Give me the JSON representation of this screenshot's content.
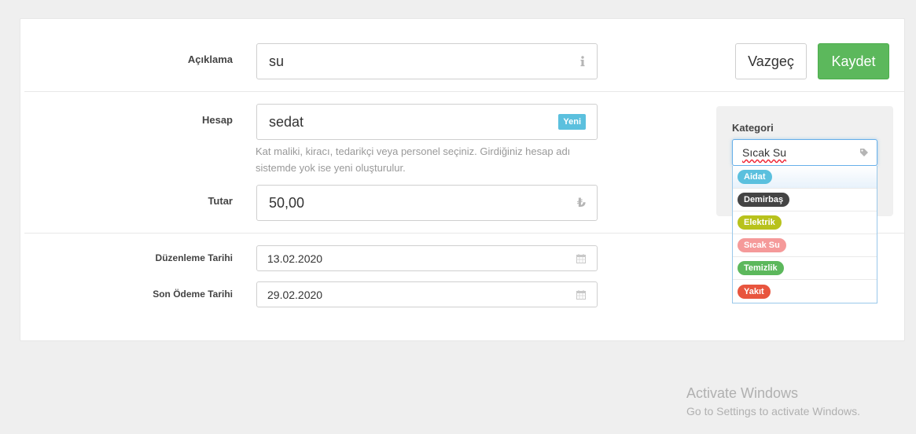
{
  "form": {
    "aciklama_label": "Açıklama",
    "aciklama_value": "su",
    "hesap_label": "Hesap",
    "hesap_value": "sedat",
    "hesap_badge": "Yeni",
    "hesap_help_line1": "Kat maliki, kiracı, tedarikçi veya personel seçiniz. Girdiğiniz hesap adı",
    "hesap_help_line2": "sistemde yok ise yeni oluşturulur.",
    "tutar_label": "Tutar",
    "tutar_value": "50,00",
    "tutar_currency": "₺",
    "duzenleme_label": "Düzenleme Tarihi",
    "duzenleme_value": "13.02.2020",
    "son_odeme_label": "Son Ödeme Tarihi",
    "son_odeme_value": "29.02.2020"
  },
  "buttons": {
    "cancel_label": "Vazgeç",
    "save_label": "Kaydet"
  },
  "category": {
    "title": "Kategori",
    "input_value": "Sıcak Su",
    "options": [
      {
        "label": "Aidat",
        "color": "#5bc0de"
      },
      {
        "label": "Demirbaş",
        "color": "#444444"
      },
      {
        "label": "Elektrik",
        "color": "#b8c21c"
      },
      {
        "label": "Sıcak Su",
        "color": "#f59a9a"
      },
      {
        "label": "Temizlik",
        "color": "#5cb85c"
      },
      {
        "label": "Yakıt",
        "color": "#e8553e"
      }
    ]
  },
  "watermark": {
    "line1": "Activate Windows",
    "line2": "Go to Settings to activate Windows."
  },
  "icons": {
    "info": "info-icon",
    "calendar": "calendar-icon",
    "tag": "tag-icon"
  }
}
